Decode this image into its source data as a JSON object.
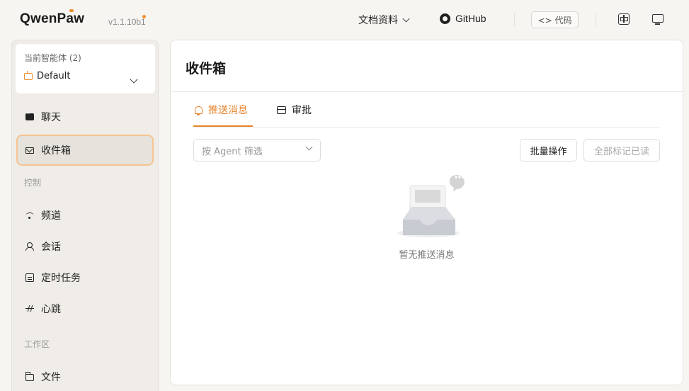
{
  "header": {
    "logo_text_a": "QwenP",
    "logo_text_b": "aw",
    "version": "v1.1.10b1",
    "docs_label": "文档资料",
    "github_label": "GitHub",
    "code_label": "<> 代码"
  },
  "sidebar": {
    "agent_label": "当前智能体 (2)",
    "agent_value": "Default",
    "items": [
      {
        "label": "聊天"
      },
      {
        "label": "收件箱"
      },
      {
        "label": "频道"
      },
      {
        "label": "会话"
      },
      {
        "label": "定时任务"
      },
      {
        "label": "心跳"
      },
      {
        "label": "文件"
      }
    ],
    "sections": {
      "control": "控制",
      "workspace": "工作区"
    }
  },
  "main": {
    "title": "收件箱",
    "tabs": [
      {
        "label": "推送消息"
      },
      {
        "label": "审批"
      }
    ],
    "filter_placeholder": "按 Agent 筛选",
    "batch_button": "批量操作",
    "mark_all_button": "全部标记已读",
    "empty_text": "暂无推送消息"
  },
  "colors": {
    "accent": "#e8822a",
    "active_border": "#f5c591"
  }
}
